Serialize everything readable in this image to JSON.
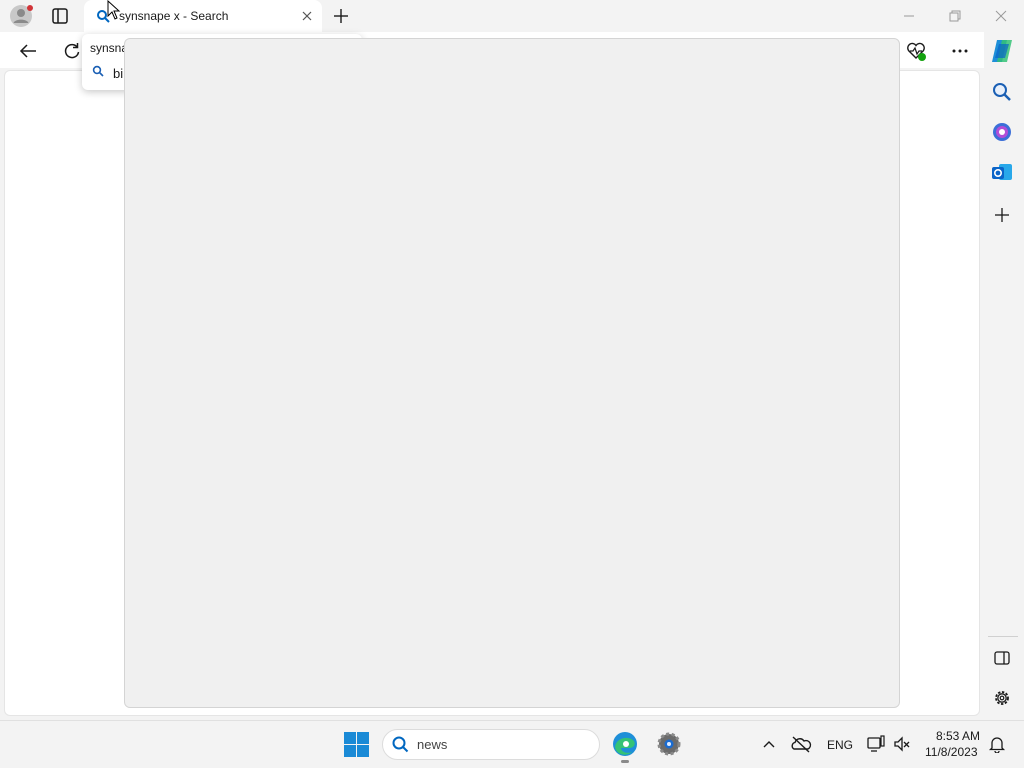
{
  "browser": {
    "tab": {
      "title": "synsnape x - Search",
      "icon": "search-icon"
    },
    "window_controls": [
      "minimize",
      "restore",
      "close"
    ]
  },
  "omnibox_dropdown": {
    "typed_text": "synsna",
    "suggestion_text": "bi"
  },
  "sidebar": {
    "items": [
      "search-icon",
      "office-icon",
      "outlook-icon",
      "add-icon",
      "split-screen-icon",
      "settings-icon"
    ]
  },
  "taskbar": {
    "search_value": "news",
    "language": "ENG",
    "time": "8:53 AM",
    "date": "11/8/2023"
  },
  "colors": {
    "accent": "#0067c0",
    "edge_blue": "#1e8fd8",
    "edge_green": "#34c276",
    "outlook_blue": "#0a64c8",
    "notification_red": "#d13438"
  }
}
